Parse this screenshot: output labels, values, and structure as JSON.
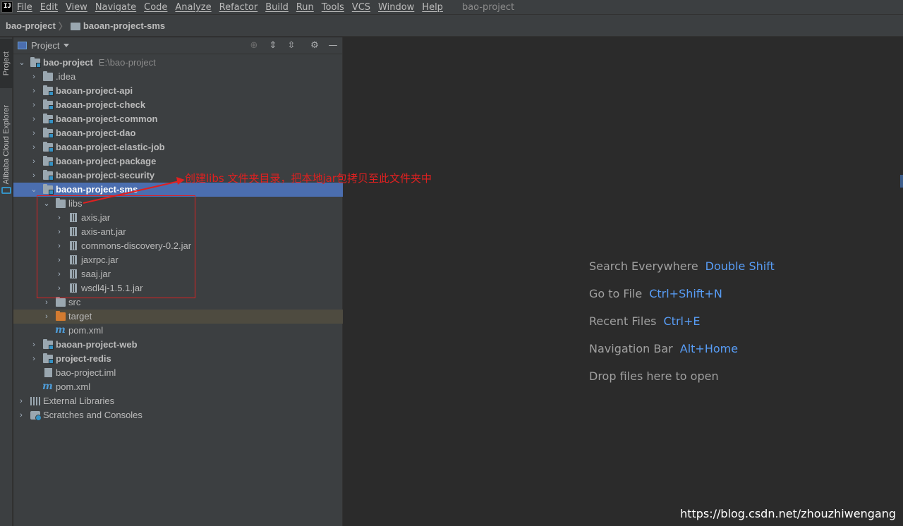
{
  "menubar": {
    "items": [
      "File",
      "Edit",
      "View",
      "Navigate",
      "Code",
      "Analyze",
      "Refactor",
      "Build",
      "Run",
      "Tools",
      "VCS",
      "Window",
      "Help"
    ],
    "project_title": "bao-project"
  },
  "breadcrumb": {
    "root": "bao-project",
    "module": "baoan-project-sms"
  },
  "tool_stripe": {
    "project_tab": "Project",
    "alibaba_tab": "Alibaba Cloud Explorer"
  },
  "project_panel": {
    "title": "Project",
    "tree": [
      {
        "label": "bao-project",
        "path": "E:\\bao-project"
      },
      {
        "label": ".idea"
      },
      {
        "label": "baoan-project-api"
      },
      {
        "label": "baoan-project-check"
      },
      {
        "label": "baoan-project-common"
      },
      {
        "label": "baoan-project-dao"
      },
      {
        "label": "baoan-project-elastic-job"
      },
      {
        "label": "baoan-project-package"
      },
      {
        "label": "baoan-project-security"
      },
      {
        "label": "baoan-project-sms"
      },
      {
        "label": "libs"
      },
      {
        "label": "axis.jar"
      },
      {
        "label": "axis-ant.jar"
      },
      {
        "label": "commons-discovery-0.2.jar"
      },
      {
        "label": "jaxrpc.jar"
      },
      {
        "label": "saaj.jar"
      },
      {
        "label": "wsdl4j-1.5.1.jar"
      },
      {
        "label": "src"
      },
      {
        "label": "target"
      },
      {
        "label": "pom.xml"
      },
      {
        "label": "baoan-project-web"
      },
      {
        "label": "project-redis"
      },
      {
        "label": "bao-project.iml"
      },
      {
        "label": "pom.xml"
      },
      {
        "label": "External Libraries"
      },
      {
        "label": "Scratches and Consoles"
      }
    ]
  },
  "annotation": {
    "text": "创建libs 文件夹目录，把本地jar包拷贝至此文件夹中",
    "color": "#e02020"
  },
  "editor": {
    "hints": [
      {
        "label": "Search Everywhere",
        "key": "Double Shift"
      },
      {
        "label": "Go to File",
        "key": "Ctrl+Shift+N"
      },
      {
        "label": "Recent Files",
        "key": "Ctrl+E"
      },
      {
        "label": "Navigation Bar",
        "key": "Alt+Home"
      },
      {
        "label": "Drop files here to open",
        "key": ""
      }
    ]
  },
  "watermark": "https://blog.csdn.net/zhouzhiwengang",
  "colors": {
    "accent": "#4b6eaf",
    "shortcut": "#589df6",
    "excluded_row": "#4e4b40",
    "excluded_folder": "#d37b30"
  }
}
